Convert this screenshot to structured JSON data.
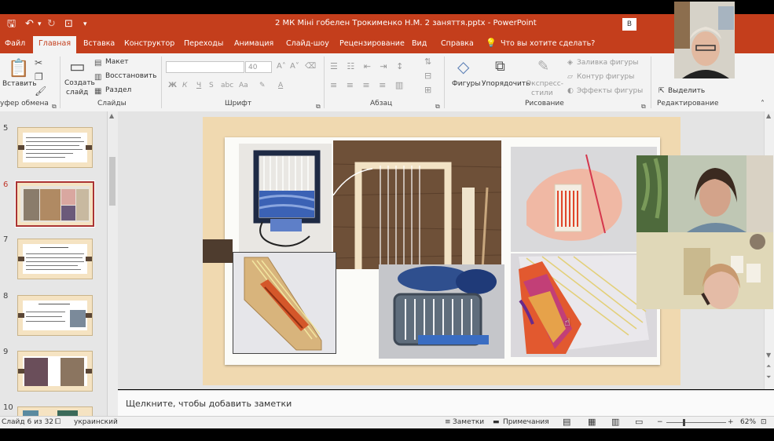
{
  "titlebar": {
    "title": "2 МК Міні гобелен Трокименко Н.М. 2 заняття.pptx - PowerPoint",
    "window_button": "В"
  },
  "tabs": [
    {
      "label": "Файл"
    },
    {
      "label": "Главная",
      "active": true
    },
    {
      "label": "Вставка"
    },
    {
      "label": "Конструктор"
    },
    {
      "label": "Переходы"
    },
    {
      "label": "Анимация"
    },
    {
      "label": "Слайд-шоу"
    },
    {
      "label": "Рецензирование"
    },
    {
      "label": "Вид"
    },
    {
      "label": "Справка"
    }
  ],
  "tell_me": "Что вы хотите сделать?",
  "ribbon": {
    "clipboard": {
      "paste": "Вставить",
      "label": "уфер обмена"
    },
    "slides": {
      "new_slide": "Создать",
      "new_slide2": "слайд",
      "layout": "Макет",
      "reset": "Восстановить",
      "section": "Раздел",
      "label": "Слайды"
    },
    "font": {
      "size": "40",
      "bold": "Ж",
      "italic": "К",
      "underline": "Ч",
      "strike": "S",
      "spacing": "abc",
      "case": "Аа",
      "label": "Шрифт"
    },
    "paragraph": {
      "label": "Абзац"
    },
    "drawing": {
      "shapes": "Фигуры",
      "arrange": "Упорядочить",
      "quick_styles": "Экспресс-",
      "quick_styles2": "стили",
      "fill": "Заливка фигуры",
      "outline": "Контур фигуры",
      "effects": "Эффекты фигуры",
      "label": "Рисование"
    },
    "editing": {
      "select": "Выделить",
      "label": "Редактирование"
    }
  },
  "thumbnails": [
    {
      "num": "5"
    },
    {
      "num": "6",
      "selected": true
    },
    {
      "num": "7"
    },
    {
      "num": "8"
    },
    {
      "num": "9"
    },
    {
      "num": "10"
    }
  ],
  "notes_placeholder": "Щелкните, чтобы добавить заметки",
  "statusbar": {
    "slide_counter": "Слайд 6 из 32",
    "language": "украинский",
    "notes": "Заметки",
    "comments": "Примечания",
    "zoom": "62%",
    "zoom_level": 0.62
  }
}
